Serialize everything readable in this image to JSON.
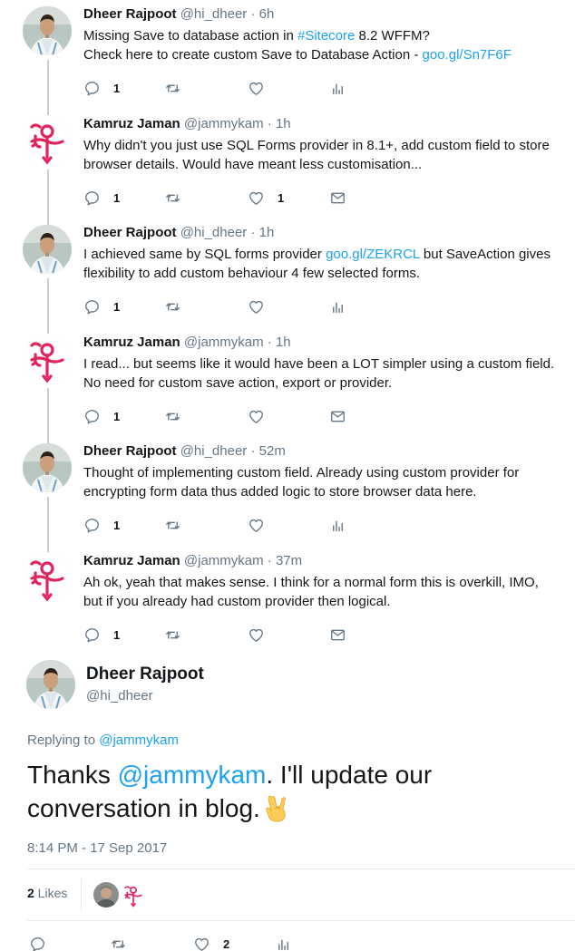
{
  "colors": {
    "link": "#1da1f2",
    "secondary_text": "#657786",
    "thread_line": "#c4cfd6",
    "prince_symbol": "#e0245e"
  },
  "tweets": [
    {
      "name": "Dheer Rajpoot",
      "handle": "@hi_dheer",
      "time": "6h",
      "avatar": "person-photo",
      "lines": [
        [
          "Missing Save to database action in ",
          {
            "link": "#Sitecore"
          },
          " 8.2 WFFM?"
        ],
        [
          "Check here to create custom Save to Database Action - ",
          {
            "link": "goo.gl/Sn7F6F"
          }
        ]
      ],
      "reply_count": "1",
      "retweet_count": "",
      "like_count": "",
      "extra_icon": "analytics-icon"
    },
    {
      "name": "Kamruz Jaman",
      "handle": "@jammykam",
      "time": "1h",
      "avatar": "prince-symbol",
      "lines": [
        [
          "Why didn't you just use SQL Forms provider in 8.1+, add custom field to store"
        ],
        [
          "browser details. Would have meant less customisation..."
        ]
      ],
      "reply_count": "1",
      "retweet_count": "",
      "like_count": "1",
      "extra_icon": "message-icon"
    },
    {
      "name": "Dheer Rajpoot",
      "handle": "@hi_dheer",
      "time": "1h",
      "avatar": "person-photo",
      "lines": [
        [
          "I achieved same by SQL forms provider ",
          {
            "link": "goo.gl/ZEKRCL"
          },
          " but SaveAction gives"
        ],
        [
          "flexibility to add custom behaviour 4 few selected forms."
        ]
      ],
      "reply_count": "1",
      "retweet_count": "",
      "like_count": "",
      "extra_icon": "analytics-icon"
    },
    {
      "name": "Kamruz Jaman",
      "handle": "@jammykam",
      "time": "1h",
      "avatar": "prince-symbol",
      "lines": [
        [
          "I read... but seems like it would have been a LOT simpler using a custom field."
        ],
        [
          "No need for custom save action, export or provider."
        ]
      ],
      "reply_count": "1",
      "retweet_count": "",
      "like_count": "",
      "extra_icon": "message-icon"
    },
    {
      "name": "Dheer Rajpoot",
      "handle": "@hi_dheer",
      "time": "52m",
      "avatar": "person-photo",
      "lines": [
        [
          "Thought of implementing custom field. Already using custom provider for"
        ],
        [
          "encrypting form data thus added logic to store browser data here."
        ]
      ],
      "reply_count": "1",
      "retweet_count": "",
      "like_count": "",
      "extra_icon": "analytics-icon"
    },
    {
      "name": "Kamruz Jaman",
      "handle": "@jammykam",
      "time": "37m",
      "avatar": "prince-symbol",
      "lines": [
        [
          "Ah ok, yeah that makes sense. I think for a normal form this is overkill, IMO,"
        ],
        [
          "but if you already had custom provider then logical."
        ]
      ],
      "reply_count": "1",
      "retweet_count": "",
      "like_count": "",
      "extra_icon": "message-icon"
    }
  ],
  "main_tweet": {
    "name": "Dheer Rajpoot",
    "handle": "@hi_dheer",
    "replying_prefix": "Replying to ",
    "replying_to": "@jammykam",
    "text_line1_before": "Thanks ",
    "text_mention": "@jammykam",
    "text_line1_after": ". I'll update our",
    "text_line2": "conversation in blog.",
    "emoji": "sign-of-the-horns-emoji",
    "timestamp": "8:14 PM - 17 Sep 2017",
    "likes_count": "2",
    "likes_label": " Likes",
    "reply_count": "",
    "retweet_count": "",
    "like_count": "2",
    "extra_icon": "analytics-icon"
  }
}
